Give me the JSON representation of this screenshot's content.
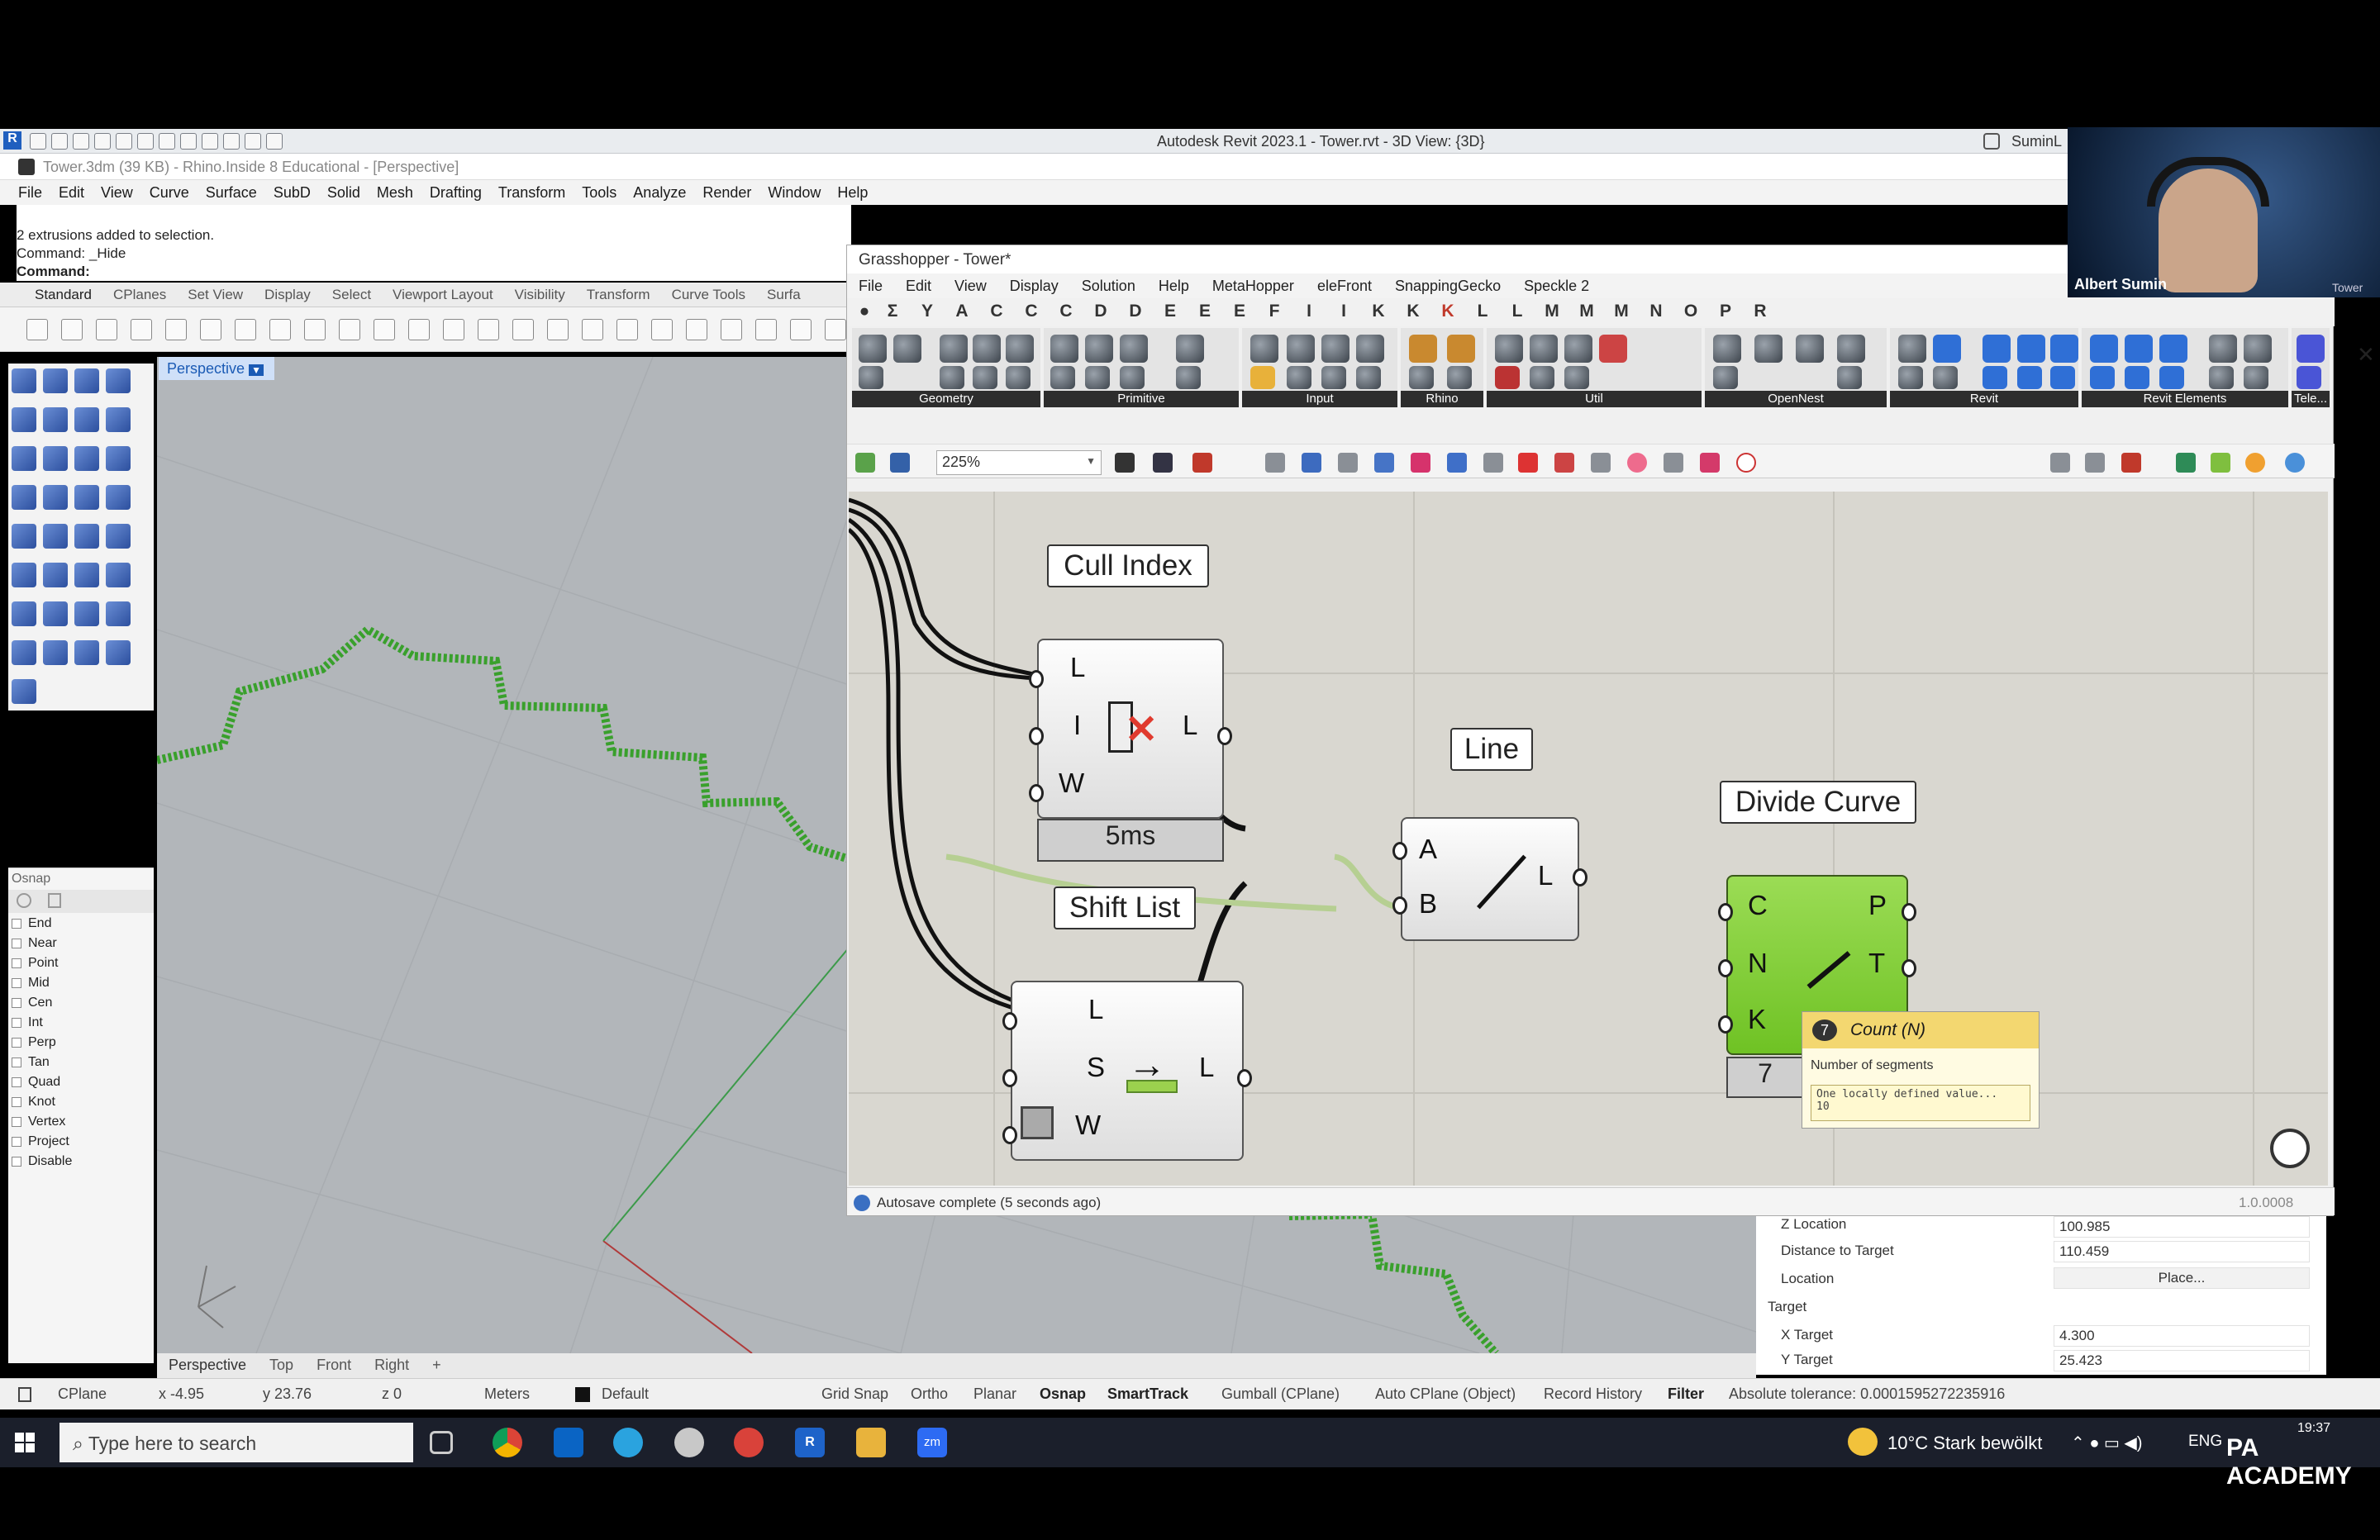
{
  "revit": {
    "title": "Autodesk Revit 2023.1 - Tower.rvt - 3D View: {3D}",
    "user": "SuminL"
  },
  "rhino": {
    "title": "Tower.3dm (39 KB) - Rhino.Inside 8 Educational - [Perspective]",
    "menu": [
      "File",
      "Edit",
      "View",
      "Curve",
      "Surface",
      "SubD",
      "Solid",
      "Mesh",
      "Drafting",
      "Transform",
      "Tools",
      "Analyze",
      "Render",
      "Window",
      "Help"
    ],
    "history": [
      "2 extrusions added to selection.",
      "Command: _Hide"
    ],
    "command_label": "Command:",
    "tabs": [
      "Standard",
      "CPlanes",
      "Set View",
      "Display",
      "Select",
      "Viewport Layout",
      "Visibility",
      "Transform",
      "Curve Tools",
      "Surfa"
    ],
    "viewport_title": "Perspective",
    "view_tabs": [
      "Perspective",
      "Top",
      "Front",
      "Right"
    ],
    "osnap": {
      "title": "Osnap",
      "items": [
        "End",
        "Near",
        "Point",
        "Mid",
        "Cen",
        "Int",
        "Perp",
        "Tan",
        "Quad",
        "Knot",
        "Vertex",
        "Project",
        "Disable"
      ]
    }
  },
  "status": {
    "cplane": "CPlane",
    "x": "x -4.95",
    "y": "y 23.76",
    "z": "z 0",
    "units": "Meters",
    "layer": "Default",
    "toggles": [
      "Grid Snap",
      "Ortho",
      "Planar",
      "Osnap",
      "SmartTrack",
      "Gumball (CPlane)",
      "Auto CPlane (Object)",
      "Record History",
      "Filter"
    ],
    "tolerance": "Absolute tolerance: 0.0001595272235916"
  },
  "properties": {
    "rows": [
      {
        "label": "Z Location",
        "value": "100.985"
      },
      {
        "label": "Distance to Target",
        "value": "110.459"
      },
      {
        "label": "Location",
        "value": "Place..."
      }
    ],
    "section": "Target",
    "target_rows": [
      {
        "label": "X Target",
        "value": "4.300"
      },
      {
        "label": "Y Target",
        "value": "25.423"
      }
    ]
  },
  "grasshopper": {
    "title": "Grasshopper - Tower*",
    "menu": [
      "File",
      "Edit",
      "View",
      "Display",
      "Solution",
      "Help",
      "MetaHopper",
      "eleFront",
      "SnappingGecko",
      "Speckle 2"
    ],
    "tab_letters": [
      "Σ",
      "Y",
      "A",
      "C",
      "C",
      "C",
      "D",
      "D",
      "E",
      "E",
      "E",
      "F",
      "I",
      "I",
      "K",
      "K",
      "K",
      "L",
      "L",
      "M",
      "M",
      "M",
      "N",
      "O",
      "P",
      "R"
    ],
    "ribbon_groups": [
      "Geometry",
      "Primitive",
      "Input",
      "Rhino",
      "Util",
      "OpenNest",
      "Revit",
      "Revit Elements",
      "Tele..."
    ],
    "zoom": "225%",
    "status": "Autosave complete (5 seconds ago)",
    "version": "1.0.0008",
    "components": {
      "cull": {
        "label": "Cull Index",
        "inputs": [
          "L",
          "I",
          "W"
        ],
        "output": "L",
        "time": "5ms"
      },
      "shift": {
        "label": "Shift List",
        "inputs": [
          "L",
          "S",
          "W"
        ],
        "output": "L"
      },
      "line": {
        "label": "Line",
        "inputs": [
          "A",
          "B"
        ],
        "output": "L"
      },
      "divide": {
        "label": "Divide Curve",
        "inputs": [
          "C",
          "N",
          "K"
        ],
        "outputs": [
          "P",
          "T"
        ],
        "badge": "7"
      }
    },
    "tooltip": {
      "title": "Count (N)",
      "badge": "7",
      "desc": "Number of segments",
      "detail": "One locally defined value...",
      "value": "10"
    }
  },
  "webcam": {
    "name": "Albert Sumin",
    "side_label": "Tower"
  },
  "taskbar": {
    "search": "Type here to search",
    "weather": "10°C  Stark bewölkt",
    "lang": "ENG",
    "time": "19:37",
    "brand": "PA ACADEMY"
  }
}
